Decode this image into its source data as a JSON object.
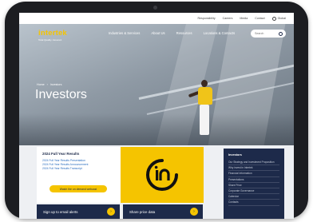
{
  "utility_bar": {
    "links": [
      "Responsibility",
      "Careers",
      "Media",
      "Contact"
    ],
    "language": "Global"
  },
  "nav": {
    "brand": "intertek",
    "tagline": "Total Quality. Assured.",
    "links": [
      "Industries & Services",
      "About Us",
      "Resources",
      "Locations & Contacts"
    ],
    "search_placeholder": "Search"
  },
  "hero": {
    "breadcrumb": [
      "Home",
      "Investors"
    ],
    "title": "Investors"
  },
  "results_card": {
    "title": "2024 Full Year Results",
    "links": [
      "2024 Full Year Results Presentation",
      "2024 Full Year Results Announcement",
      "2024 Full Year Results Transcript"
    ],
    "button_label": "Watch the on demand webcast"
  },
  "sidebar": {
    "title": "Investors",
    "items": [
      "Our Strategy and Investment Proposition",
      "Why invest in Intertek",
      "Financial Information",
      "Presentations",
      "Share Price",
      "Corporate Governance",
      "Calendar",
      "Contacts"
    ]
  },
  "bottom": {
    "email_label": "Sign up to email alerts",
    "price_label": "Share price data"
  },
  "colors": {
    "accent": "#f5c400",
    "navy": "#1d2a4a",
    "frame": "#1c1d21"
  }
}
